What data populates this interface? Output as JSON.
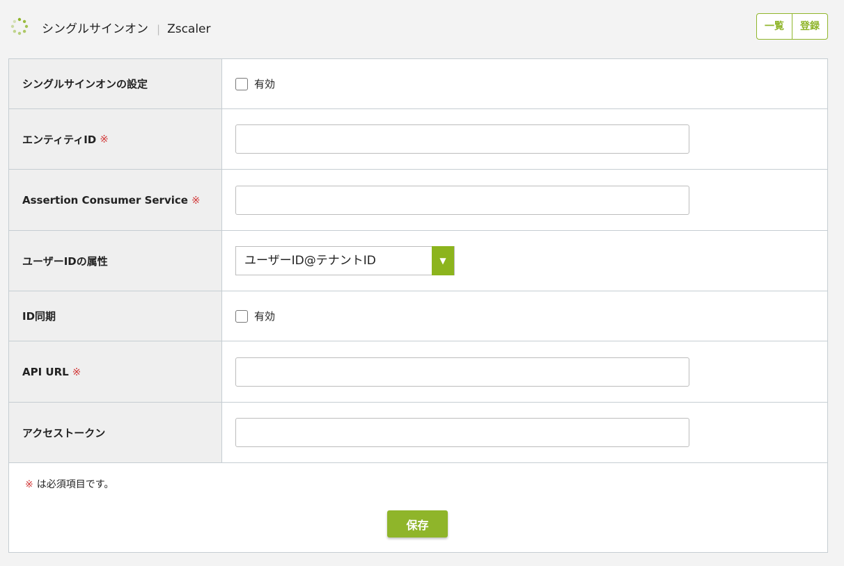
{
  "header": {
    "title": "シングルサインオン",
    "separator": "|",
    "subtitle": "Zscaler",
    "list_button": "一覧",
    "register_button": "登録",
    "logo_icon": "spinner-dots-icon",
    "accent_color": "#8fb52a"
  },
  "required_mark": "※",
  "rows": [
    {
      "label": "シングルサインオンの設定",
      "type": "checkbox",
      "checkbox_label": "有効",
      "checked": false
    },
    {
      "label": "エンティティID",
      "required": true,
      "type": "text",
      "value": ""
    },
    {
      "label": "Assertion Consumer Service",
      "required": true,
      "type": "text",
      "value": ""
    },
    {
      "label": "ユーザーIDの属性",
      "type": "select",
      "value": "ユーザーID@テナントID",
      "arrow": "▼"
    },
    {
      "label": "ID同期",
      "type": "checkbox",
      "checkbox_label": "有効",
      "checked": false
    },
    {
      "label": "API URL",
      "required": true,
      "type": "text",
      "value": ""
    },
    {
      "label": "アクセストークン",
      "type": "text",
      "value": ""
    }
  ],
  "footer": {
    "note_mark": "※",
    "note_text": "は必須項目です。",
    "save_button": "保存"
  }
}
